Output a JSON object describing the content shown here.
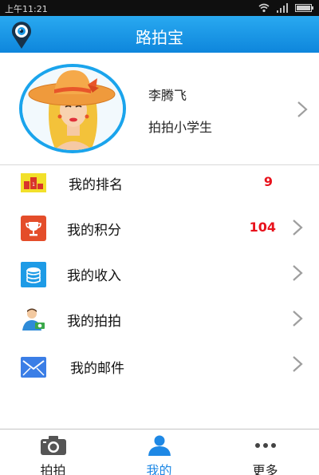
{
  "status_bar": {
    "time": "上午11:21"
  },
  "app_bar": {
    "title": "路拍宝",
    "logo_icon": "map-pin-eye-icon"
  },
  "profile": {
    "name": "李腾飞",
    "level": "拍拍小学生",
    "avatar_icon": "avatar-lady-in-hat"
  },
  "menu": [
    {
      "icon": "ranking-podium-icon",
      "label": "我的排名",
      "value": "9",
      "has_chevron": false
    },
    {
      "icon": "trophy-icon",
      "label": "我的积分",
      "value": "104",
      "has_chevron": true
    },
    {
      "icon": "coins-stack-icon",
      "label": "我的收入",
      "value": "",
      "has_chevron": true
    },
    {
      "icon": "photographer-icon",
      "label": "我的拍拍",
      "value": "",
      "has_chevron": true
    },
    {
      "icon": "envelope-icon",
      "label": "我的邮件",
      "value": "",
      "has_chevron": true
    }
  ],
  "tabs": [
    {
      "icon": "camera-icon",
      "label": "拍拍",
      "active": false
    },
    {
      "icon": "user-icon",
      "label": "我的",
      "active": true
    },
    {
      "icon": "more-dots-icon",
      "label": "更多",
      "active": false
    }
  ],
  "colors": {
    "accent_blue": "#1e88e5",
    "app_bar": "#1898e6",
    "value_red": "#e8121c",
    "divider": "#d8d8d8"
  }
}
